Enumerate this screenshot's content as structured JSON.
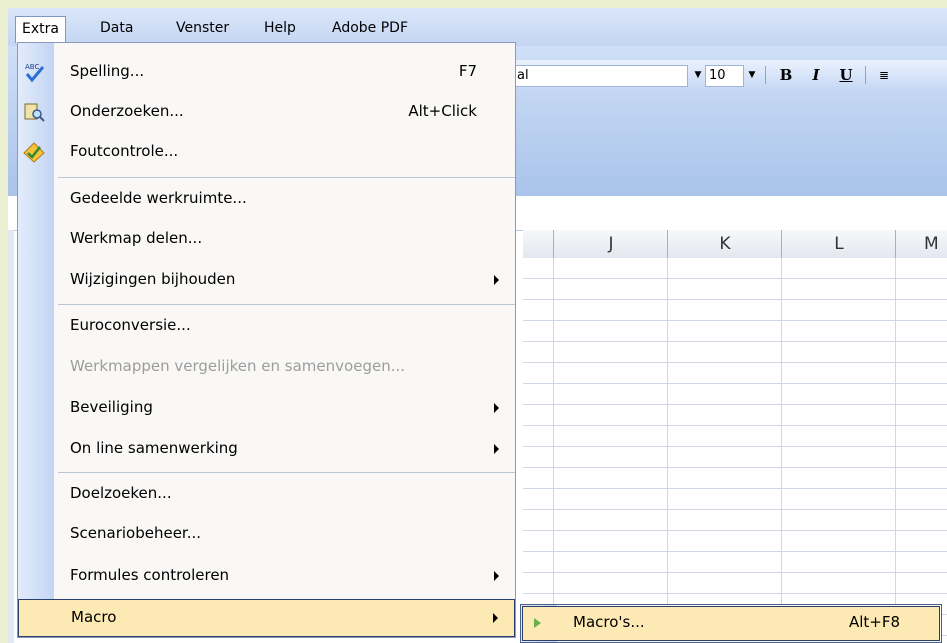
{
  "menubar": {
    "items": [
      "Extra",
      "Data",
      "Venster",
      "Help",
      "Adobe PDF"
    ]
  },
  "toolbar": {
    "font_name_fragment": "al",
    "font_size": "10",
    "bold_label": "B",
    "italic_label": "I",
    "underline_label": "U"
  },
  "grid": {
    "columns": [
      "J",
      "K",
      "L",
      "M"
    ]
  },
  "extra_menu": {
    "items": [
      {
        "label": "Spelling...",
        "shortcut": "F7",
        "icon": "spelling-icon"
      },
      {
        "label": "Onderzoeken...",
        "shortcut": "Alt+Click",
        "icon": "research-icon"
      },
      {
        "label": "Foutcontrole...",
        "icon": "error-check-icon"
      },
      {
        "label": "Gedeelde werkruimte..."
      },
      {
        "label": "Werkmap delen..."
      },
      {
        "label": "Wijzigingen bijhouden",
        "submenu": true
      },
      {
        "label": "Euroconversie..."
      },
      {
        "label": "Werkmappen vergelijken en samenvoegen...",
        "disabled": true
      },
      {
        "label": "Beveiliging",
        "submenu": true
      },
      {
        "label": "On line samenwerking",
        "submenu": true
      },
      {
        "label": "Doelzoeken..."
      },
      {
        "label": "Scenariobeheer..."
      },
      {
        "label": "Formules controleren",
        "submenu": true
      },
      {
        "label": "Macro",
        "submenu": true,
        "highlighted": true
      }
    ]
  },
  "macro_submenu": {
    "label": "Macro's...",
    "shortcut": "Alt+F8"
  },
  "colors": {
    "highlight": "#fde9b4",
    "background": "#ecf0d2"
  }
}
